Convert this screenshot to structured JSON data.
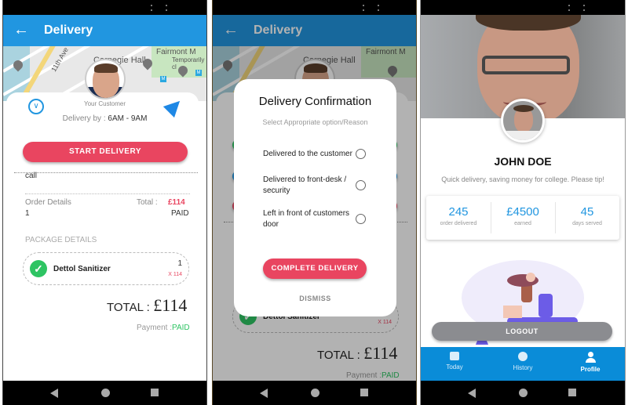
{
  "screen1": {
    "app_bar": {
      "title": "Delivery",
      "back_icon": "arrow-left-icon"
    },
    "map": {
      "labels": [
        "11th Ave",
        "Carnegie Hall",
        "Temporarily closed",
        "Fairmont M",
        "Temporarily cl"
      ],
      "metro_label": "M"
    },
    "customer": {
      "label": "Your Customer",
      "delivery_by_label": "Delivery by :",
      "delivery_window": "6AM - 9AM"
    },
    "start_button": "START DELIVERY",
    "call_label": "call",
    "order": {
      "label": "Order Details",
      "count": "1",
      "total_label": "Total :",
      "total_value": "£114",
      "status": "PAID"
    },
    "package_header": "PACKAGE DETAILS",
    "package": {
      "name": "Dettol Sanitizer",
      "qty": "1",
      "price": "X 114"
    },
    "total": {
      "label": "TOTAL :",
      "value": "£114"
    },
    "payment": {
      "label": "Payment :",
      "status": "PAID"
    },
    "colors": {
      "primary": "#2196e0",
      "accent_red": "#e94560",
      "success": "#2ec463"
    }
  },
  "screen2": {
    "app_bar": {
      "title": "Delivery"
    },
    "dialog": {
      "title": "Delivery Confirmation",
      "subtitle": "Select Appropriate option/Reason",
      "options": [
        {
          "label": "Delivered to the customer",
          "selected": false
        },
        {
          "label": "Delivered to front-desk / security",
          "selected": false
        },
        {
          "label": "Left in front of customers door",
          "selected": false
        }
      ],
      "complete_button": "COMPLETE DELIVERY",
      "dismiss_button": "DISMISS"
    },
    "package": {
      "name": "Dettol Sanitizer",
      "price": "X 114"
    },
    "total": {
      "label": "TOTAL :",
      "value": "£114"
    },
    "payment": {
      "label": "Payment :",
      "status": "PAID"
    }
  },
  "screen3": {
    "name": "JOHN DOE",
    "bio": "Quick delivery, saving money for college. Please tip!",
    "stats": [
      {
        "value": "245",
        "label": "order delivered"
      },
      {
        "value": "£4500",
        "label": "earned"
      },
      {
        "value": "45",
        "label": "days served"
      }
    ],
    "logout_button": "LOGOUT",
    "bottom_nav": [
      {
        "label": "Today",
        "icon": "calendar-icon",
        "active": false
      },
      {
        "label": "History",
        "icon": "clock-icon",
        "active": false
      },
      {
        "label": "Profile",
        "icon": "person-icon",
        "active": true
      }
    ]
  }
}
